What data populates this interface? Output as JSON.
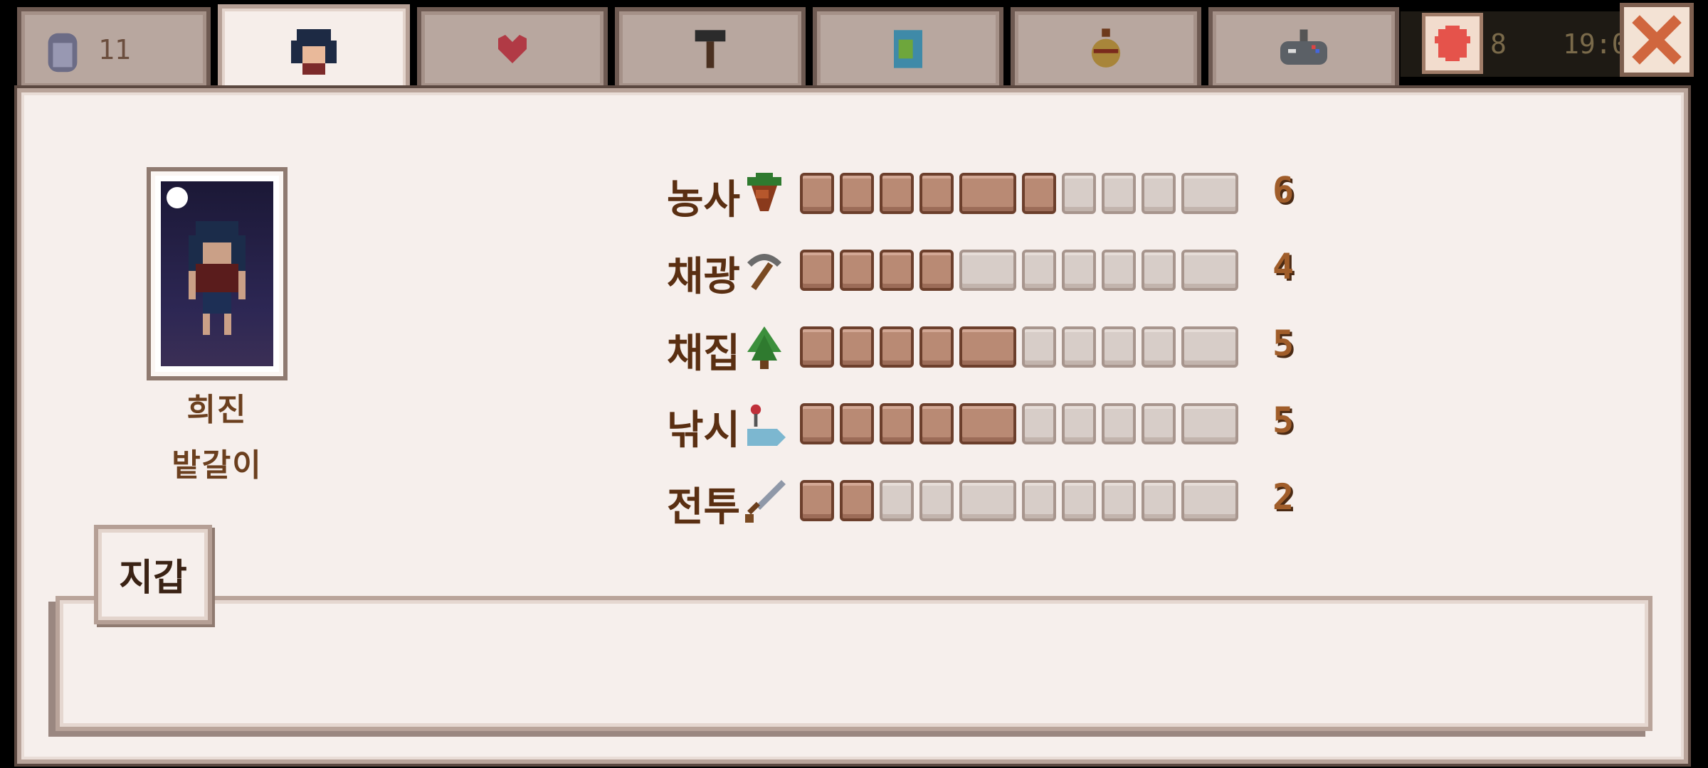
{
  "tabs": [
    {
      "id": "inventory",
      "icon": "backpack-icon",
      "label": "11"
    },
    {
      "id": "skills",
      "icon": "farmer-portrait-icon",
      "label": ""
    },
    {
      "id": "social",
      "icon": "heart-icon",
      "label": ""
    },
    {
      "id": "crafting",
      "icon": "hammer-icon",
      "label": ""
    },
    {
      "id": "map",
      "icon": "map-icon",
      "label": ""
    },
    {
      "id": "collections",
      "icon": "vase-icon",
      "label": ""
    },
    {
      "id": "options",
      "icon": "gamepad-icon",
      "label": ""
    }
  ],
  "hud": {
    "day": "8",
    "time": "19:0"
  },
  "player": {
    "name": "희진",
    "title": "밭갈이"
  },
  "skills": [
    {
      "name": "농사",
      "icon": "parsnip-icon",
      "level": 6
    },
    {
      "name": "채광",
      "icon": "pickaxe-icon",
      "level": 4
    },
    {
      "name": "채집",
      "icon": "tree-icon",
      "level": 5
    },
    {
      "name": "낚시",
      "icon": "fishing-icon",
      "level": 5
    },
    {
      "name": "전투",
      "icon": "sword-icon",
      "level": 2
    }
  ],
  "skill_levels_text": [
    "6",
    "4",
    "5",
    "5",
    "2"
  ],
  "max_level": 10,
  "wallet": {
    "label": "지갑"
  },
  "colors": {
    "panel": "#f6efec",
    "border": "#b9a49a",
    "filled": "#b98a74",
    "empty": "#d7cdc8",
    "text": "#5a2f12"
  }
}
